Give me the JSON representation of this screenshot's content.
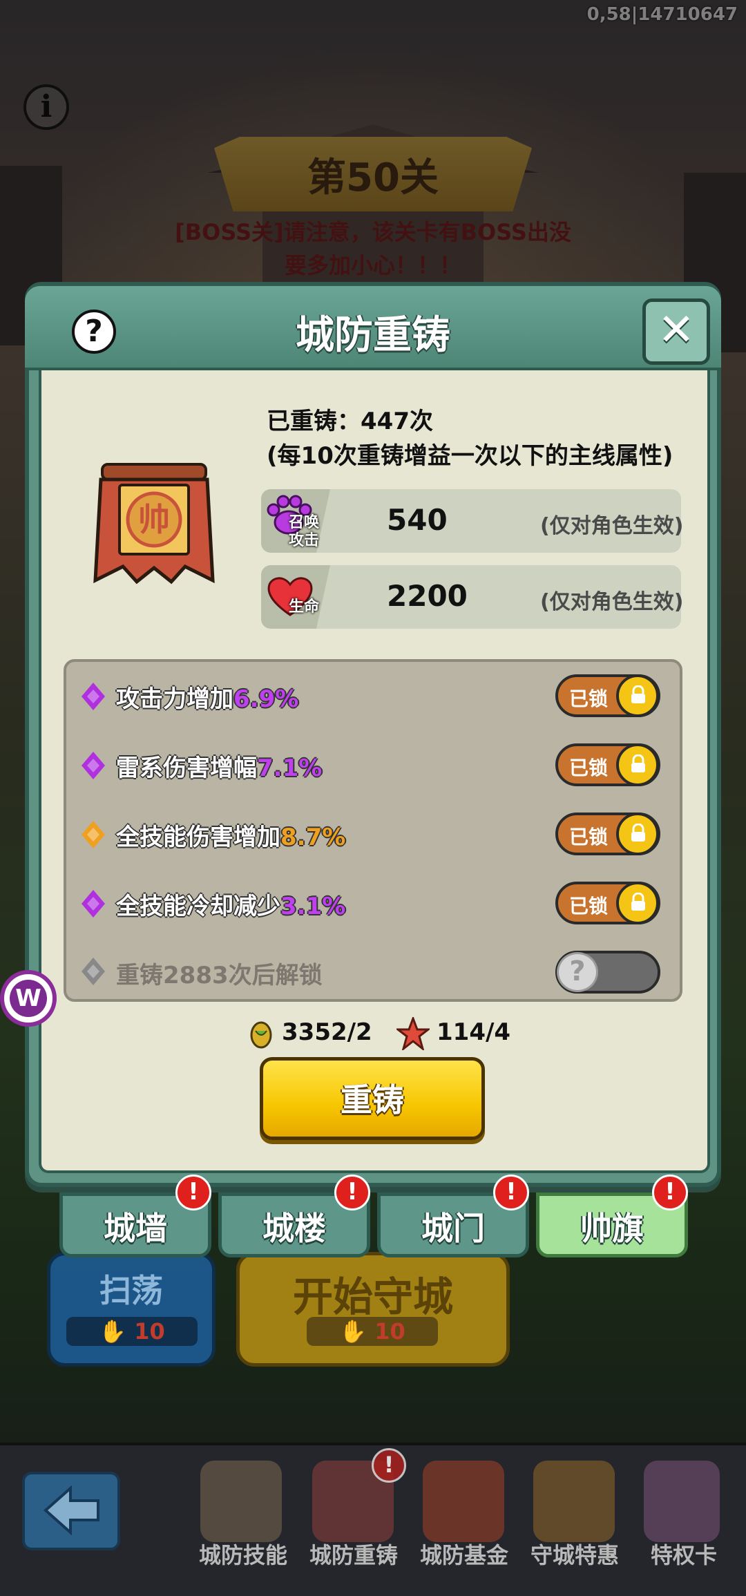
{
  "status": {
    "coord_text": "0,58|14710647"
  },
  "stage": {
    "level_title": "第50关",
    "boss_warning_line1": "[BOSS关]请注意，该关卡有BOSS出没",
    "boss_warning_line2": "要多加小心！！！"
  },
  "modal": {
    "title": "城防重铸",
    "help_label": "?",
    "close_label": "✕",
    "reforge_count": "已重铸：447次",
    "reforge_note": "(每10次重铸增益一次以下的主线属性)",
    "stats": [
      {
        "icon": "paw-icon",
        "label_line1": "召唤",
        "label_line2": "攻击",
        "value": "540",
        "note": "(仅对角色生效)"
      },
      {
        "icon": "heart-icon",
        "label_line1": "生命",
        "label_line2": "",
        "value": "2200",
        "note": "(仅对角色生效)"
      }
    ],
    "attributes": [
      {
        "text": "攻击力增加",
        "pct": "6.9%",
        "pct_color": "#c040f0",
        "gem_color": "#b030e0",
        "lock_label": "已锁"
      },
      {
        "text": "雷系伤害增幅",
        "pct": "7.1%",
        "pct_color": "#c040f0",
        "gem_color": "#b030e0",
        "lock_label": "已锁"
      },
      {
        "text": "全技能伤害增加",
        "pct": "8.7%",
        "pct_color": "#f0a020",
        "gem_color": "#f0a020",
        "lock_label": "已锁"
      },
      {
        "text": "全技能冷却减少",
        "pct": "3.1%",
        "pct_color": "#c040f0",
        "gem_color": "#b030e0",
        "lock_label": "已锁"
      }
    ],
    "locked_attribute": {
      "text": "重铸2883次后解锁",
      "knob": "?"
    },
    "resources": [
      {
        "icon": "seed-icon",
        "amount": "3352/2"
      },
      {
        "icon": "star-icon",
        "amount": "114/4"
      }
    ],
    "reforge_button": "重铸"
  },
  "tabs": [
    {
      "label": "城墙",
      "active": false,
      "badge": "!"
    },
    {
      "label": "城楼",
      "active": false,
      "badge": "!"
    },
    {
      "label": "城门",
      "active": false,
      "badge": "!"
    },
    {
      "label": "帅旗",
      "active": true,
      "badge": "!"
    }
  ],
  "background_buttons": {
    "sweep_label": "扫荡",
    "sweep_cost": "10",
    "start_label": "开始守城",
    "start_cost": "10"
  },
  "bottom_nav": [
    {
      "label": "城防技能"
    },
    {
      "label": "城防重铸",
      "badge": "!"
    },
    {
      "label": "城防基金"
    },
    {
      "label": "守城特惠"
    },
    {
      "label": "特权卡"
    }
  ],
  "side_logo": "W",
  "colors": {
    "accent_teal": "#5f9383",
    "reforge_yellow": "#f7c600",
    "lock_orange": "#c8742e",
    "badge_red": "#e0201c"
  }
}
